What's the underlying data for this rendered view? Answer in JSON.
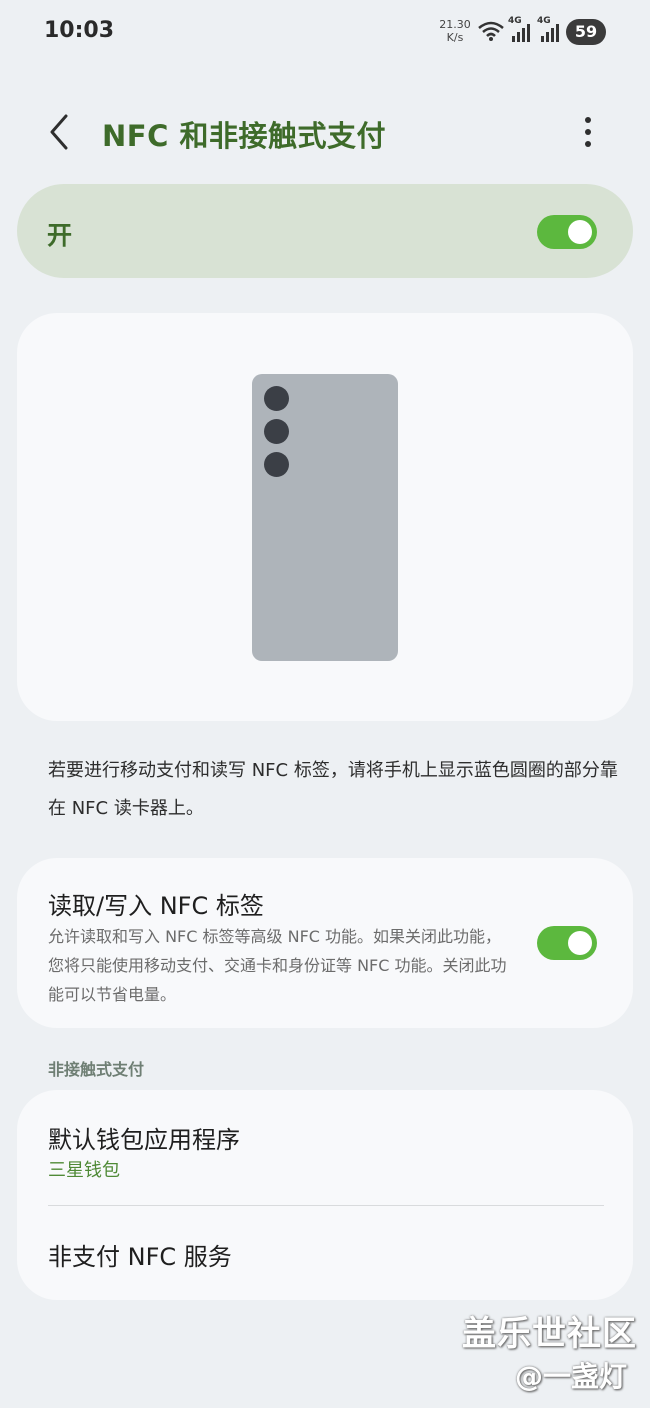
{
  "status_bar": {
    "time": "10:03",
    "net_speed_value": "21.30",
    "net_speed_unit": "K/s",
    "network1": "4G",
    "network2": "4G",
    "battery": "59"
  },
  "header": {
    "title": "NFC 和非接触式支付",
    "back_icon": "chevron-left-icon",
    "more_icon": "more-vertical-icon"
  },
  "master_switch": {
    "label": "开",
    "enabled": true
  },
  "description": "若要进行移动支付和读写 NFC 标签，请将手机上显示蓝色圆圈的部分靠在 NFC 读卡器上。",
  "nfc_tags": {
    "title": "读取/写入 NFC 标签",
    "description": "允许读取和写入 NFC 标签等高级 NFC 功能。如果关闭此功能，您将只能使用移动支付、交通卡和身份证等 NFC 功能。关闭此功能可以节省电量。",
    "enabled": true
  },
  "contactless_section": {
    "header": "非接触式支付",
    "default_wallet": {
      "title": "默认钱包应用程序",
      "value": "三星钱包"
    },
    "non_payment": {
      "title": "非支付 NFC 服务"
    }
  },
  "watermark": {
    "line1": "盖乐世社区",
    "line2": "@一盏灯"
  },
  "colors": {
    "accent": "#3e6b2a",
    "toggle_on": "#5cb83e",
    "master_card_bg": "#d8e2d4",
    "page_bg": "#edf0f3"
  }
}
